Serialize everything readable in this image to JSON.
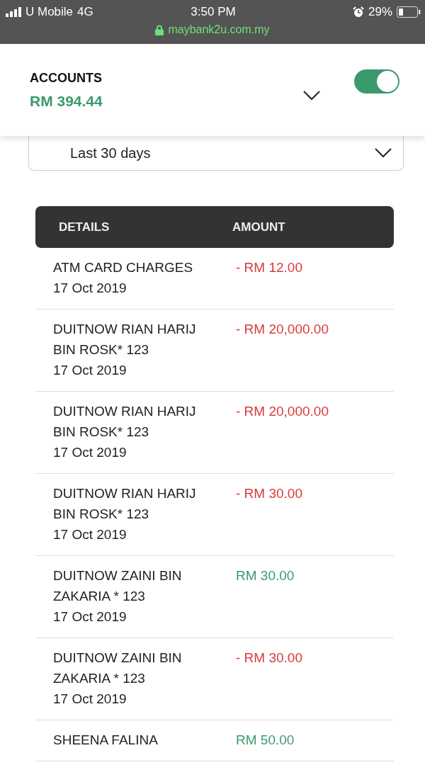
{
  "status_bar": {
    "carrier": "U Mobile",
    "network": "4G",
    "time": "3:50 PM",
    "battery": "29%",
    "url": "maybank2u.com.my"
  },
  "account": {
    "title": "ACCOUNTS",
    "balance": "RM 394.44",
    "toggle_on": true
  },
  "period": {
    "value": "Last 30 days"
  },
  "table": {
    "columns": [
      "DETAILS",
      "AMOUNT"
    ],
    "rows": [
      {
        "details": [
          "ATM CARD CHARGES",
          "17 Oct 2019"
        ],
        "amount": "- RM 12.00",
        "kind": "debit"
      },
      {
        "details": [
          "DUITNOW RIAN HARIJ BIN ROSK* 123",
          "17 Oct 2019"
        ],
        "amount": "- RM 20,000.00",
        "kind": "debit"
      },
      {
        "details": [
          "DUITNOW RIAN HARIJ BIN ROSK* 123",
          "17 Oct 2019"
        ],
        "amount": "- RM 20,000.00",
        "kind": "debit"
      },
      {
        "details": [
          "DUITNOW RIAN HARIJ BIN ROSK* 123",
          "17 Oct 2019"
        ],
        "amount": "- RM 30.00",
        "kind": "debit"
      },
      {
        "details": [
          "DUITNOW ZAINI BIN ZAKARIA * 123",
          "17 Oct 2019"
        ],
        "amount": "RM 30.00",
        "kind": "credit"
      },
      {
        "details": [
          "DUITNOW ZAINI BIN ZAKARIA * 123",
          "17 Oct 2019"
        ],
        "amount": "- RM 30.00",
        "kind": "debit"
      },
      {
        "details": [
          "SHEENA FALINA"
        ],
        "amount": "RM 50.00",
        "kind": "credit"
      }
    ]
  }
}
